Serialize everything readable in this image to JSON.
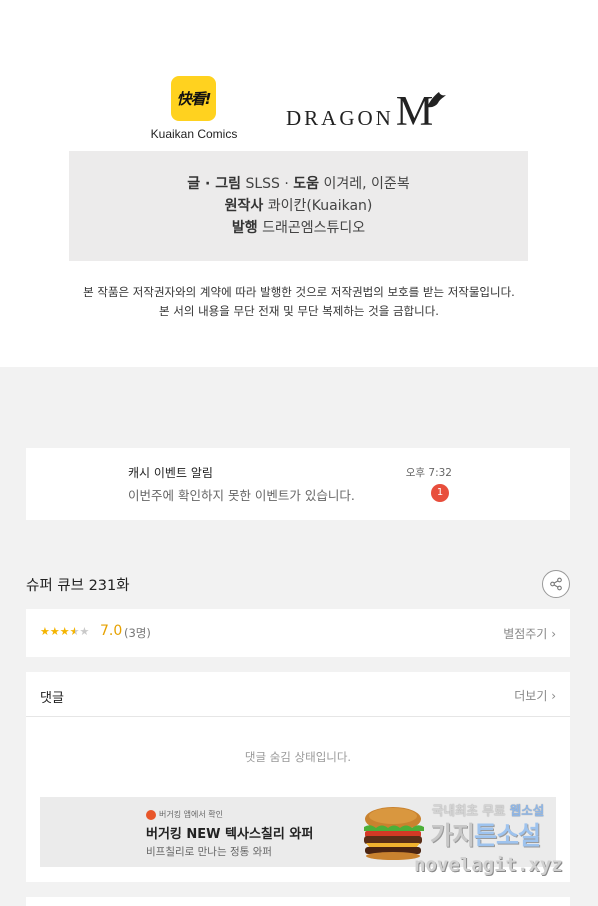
{
  "credits": {
    "kuaikan_logo_text": "快看!",
    "kuaikan_name": "Kuaikan Comics",
    "dragon_logo_word": "DRAGON",
    "dragon_logo_m": "M",
    "writer_label": "글 · 그림",
    "writer_value": "SLSS",
    "assist_label": "도움",
    "assist_value": "이겨레, 이준복",
    "original_label": "원작사",
    "original_value": "콰이칸(Kuaikan)",
    "publisher_label": "발행",
    "publisher_value": "드래곤엠스튜디오",
    "separator": " · ",
    "copyright_line1": "본 작품은 저작권자와의 계약에 따라 발행한 것으로 저작권법의 보호를 받는 저작물입니다.",
    "copyright_line2": "본 서의 내용을 무단 전재 및 무단 복제하는 것을 금합니다."
  },
  "notification": {
    "title": "캐시 이벤트 알림",
    "message": "이번주에 확인하지 못한 이벤트가 있습니다.",
    "time": "오후 7:32",
    "badge_count": "1"
  },
  "episode": {
    "title": "슈퍼 큐브 231화",
    "share_icon": "share-icon"
  },
  "rating": {
    "stars_filled": 3.5,
    "stars_max": 5,
    "score": "7.0",
    "count": "(3명)",
    "rate_link": "별점주기",
    "chevron": "›"
  },
  "comments": {
    "title": "댓글",
    "more_link": "더보기",
    "chevron": "›",
    "hidden_message": "댓글 숨김 상태입니다."
  },
  "ad": {
    "source": "버거킹 앱에서 확인",
    "title": "버거킹 NEW 텍사스칠리 와퍼",
    "subtitle": "비프칠리로 만나는 정통 와퍼"
  },
  "watermark": {
    "line1_prefix": "국내최초 무료 ",
    "line1_highlight": "웹소설",
    "line2_prefix": "가지",
    "line2_highlight": "튼소설",
    "line3": "novelagit.xyz"
  },
  "colors": {
    "accent_star": "#f4b400",
    "score": "#e6a100",
    "badge": "#e84e3c",
    "kuaikan_yellow": "#ffd21f",
    "background_grey": "#f2f2f2"
  }
}
